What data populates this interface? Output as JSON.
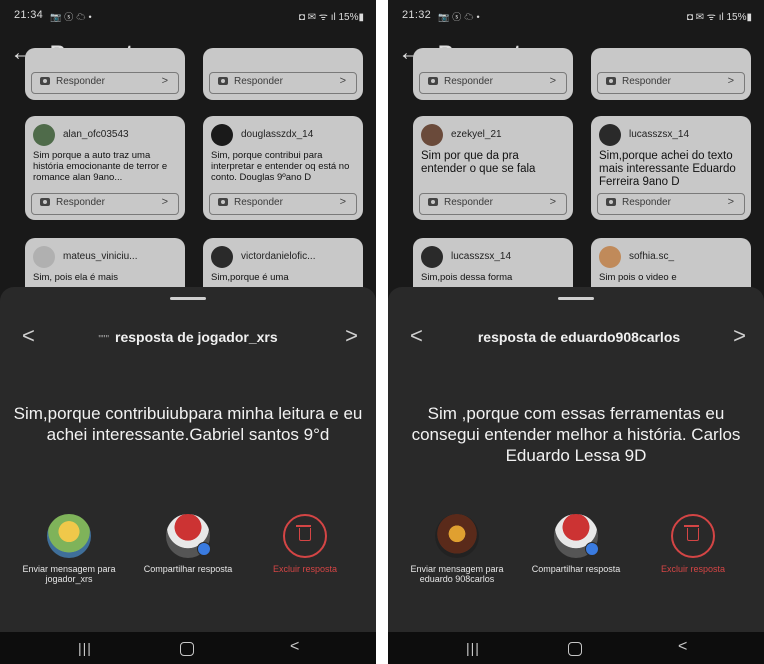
{
  "colors": {
    "background": "#191919",
    "sheet": "#292929",
    "card": "#c8c8c8",
    "danger": "#d44545",
    "accent": "#3a7be0"
  },
  "screens": [
    {
      "status": {
        "time": "21:34",
        "icons": "📷 ⓢ ☁ •",
        "right": "◘ ✉ ᯤ ıl 15%▮"
      },
      "header": {
        "title": "Respostas"
      },
      "cards": [
        {
          "username": "",
          "text": "",
          "reply": "Responder",
          "avatar_color": "#4a4a4a"
        },
        {
          "username": "",
          "text": "",
          "reply": "Responder",
          "avatar_color": "#4a4a4a"
        },
        {
          "username": "alan_ofc03543",
          "text": "Sim porque a auto traz uma história emocionante  de terror e romance  alan 9ano...",
          "reply": "Responder",
          "avatar_color": "#4f6b4a"
        },
        {
          "username": "douglasszdx_14",
          "text": "Sim, porque  contribui para interpretar e entender oq está no conto. Douglas 9ºano D",
          "reply": "Responder",
          "avatar_color": "#1a1a1a"
        },
        {
          "username": "mateus_viniciu...",
          "text": "Sim, pois ela é mais",
          "reply": "",
          "avatar_color": "#b0b0b0"
        },
        {
          "username": "victordanielofic...",
          "text": "Sim,porque é uma",
          "reply": "",
          "avatar_color": "#2a2a2a"
        }
      ],
      "sheet": {
        "title_prefix": "\"\"\"",
        "title": "resposta de jogador_xrs",
        "answer": "Sim,porque contribuiubpara minha leitura e eu achei interessante.Gabriel santos 9°d"
      },
      "actions": [
        {
          "label": "Enviar mensagem para jogador_xrs"
        },
        {
          "label": "Compartilhar resposta"
        },
        {
          "label": "Excluir resposta"
        }
      ],
      "navbar": {
        "recent": "|||",
        "back": "<"
      }
    },
    {
      "status": {
        "time": "21:32",
        "icons": "📷 ⓢ ☁ •",
        "right": "◘ ✉ ᯤ ıl 15%▮"
      },
      "header": {
        "title": "Respostas"
      },
      "cards": [
        {
          "username": "",
          "text": "",
          "reply": "Responder",
          "avatar_color": "#4a4a4a"
        },
        {
          "username": "",
          "text": "",
          "reply": "Responder",
          "avatar_color": "#4a4a4a"
        },
        {
          "username": "ezekyel_21",
          "text": "Sim por que da pra entender o que se fala",
          "reply": "Responder",
          "avatar_color": "#6a4a3a"
        },
        {
          "username": "lucasszsx_14",
          "text": "Sim,porque achei do texto mais interessante Eduardo Ferreira 9ano D",
          "reply": "Responder",
          "avatar_color": "#2a2a2a"
        },
        {
          "username": "lucasszsx_14",
          "text": "Sim,pois dessa forma",
          "reply": "",
          "avatar_color": "#2a2a2a"
        },
        {
          "username": "sofhia.sc_",
          "text": "Sim pois o video e",
          "reply": "",
          "avatar_color": "#c08a5a"
        }
      ],
      "sheet": {
        "title_prefix": "",
        "title": "resposta de eduardo908carlos",
        "answer": "Sim ,porque com essas ferramentas eu consegui entender melhor a história.  Carlos Eduardo Lessa 9D"
      },
      "actions": [
        {
          "label": "Enviar mensagem para eduardo 908carlos"
        },
        {
          "label": "Compartilhar resposta"
        },
        {
          "label": "Excluir resposta"
        }
      ],
      "navbar": {
        "recent": "|||",
        "back": "<"
      }
    }
  ]
}
